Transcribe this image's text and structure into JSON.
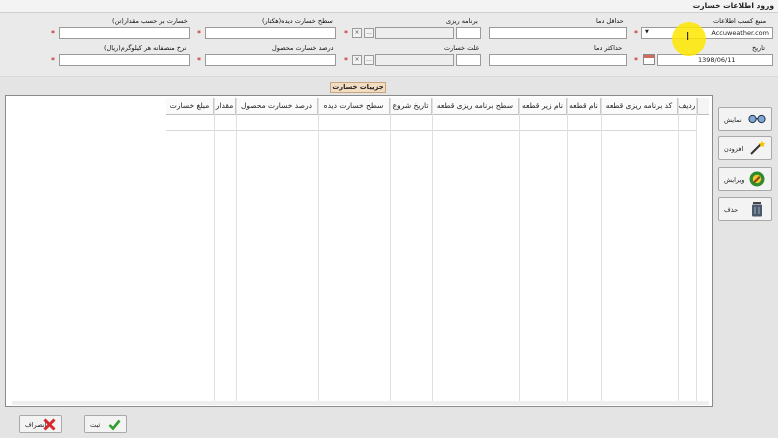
{
  "window": {
    "title": "ورود اطلاعات خسارت"
  },
  "form": {
    "source_label": "منبع کسب اطلاعات",
    "source_value": "Accuweather.com",
    "min_temp_label": "حداقل دما",
    "min_temp_value": "",
    "plan_label": "برنامه ریزی",
    "plan_value": "",
    "damage_level_ha_label": "سطح خسارت دیده(هکتار)",
    "damage_level_ha_value": "",
    "damage_amount_ton_label": "خسارت بر حسب مقدار(تن)",
    "damage_amount_ton_value": "",
    "date_label": "تاریخ",
    "date_value": "1398/06/11",
    "max_temp_label": "حداکثر دما",
    "max_temp_value": "",
    "damage_cause_label": "علت خسارت",
    "damage_cause_value": "",
    "product_damage_pct_label": "درصد خسارت محصول",
    "product_damage_pct_value": "",
    "avg_price_label": "نرخ منصفانه هر کیلوگرم(ریال)",
    "avg_price_value": "",
    "ellipsis": "...",
    "clear_x": "×",
    "dropdown_arrow": "▼",
    "required_mark": "*",
    "cursor_glyph": "I"
  },
  "details": {
    "title": "جزییات خسارت",
    "columns": [
      "ردیف",
      "کد برنامه ریزی قطعه",
      "نام قطعه",
      "نام زیر قطعه",
      "سطح برنامه ریزی قطعه",
      "تاریخ شروع",
      "سطح خسارت دیده",
      "درصد خسارت محصول",
      "مقدار",
      "مبلغ خسارت"
    ]
  },
  "side_buttons": {
    "show": "نمایش",
    "add": "افزودن",
    "edit": "ویرایش",
    "delete": "حذف"
  },
  "bottom_buttons": {
    "cancel": "انصراف",
    "submit": "ثبت"
  },
  "colors": {
    "accent_required": "#c00000",
    "highlight": "#ffe600",
    "section_title_bg": "#f2dcc2"
  },
  "icons": {
    "show": "glasses-icon",
    "add": "magic-wand-icon",
    "edit": "edit-badge-icon",
    "delete": "trash-icon",
    "cancel": "red-x-icon",
    "submit": "green-check-icon",
    "date": "calendar-icon"
  }
}
